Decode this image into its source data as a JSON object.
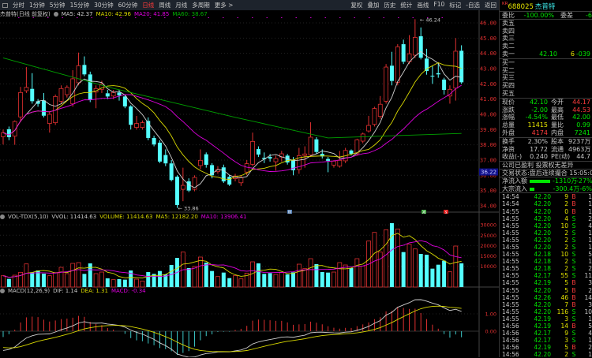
{
  "toolbar": {
    "periods": [
      "分时",
      "1分钟",
      "5分钟",
      "15分钟",
      "30分钟",
      "60分钟",
      "日线",
      "周线",
      "月线",
      "多周期",
      "更多 >"
    ],
    "active_period": "日线",
    "actions": [
      "复权",
      "叠加",
      "历史",
      "统计",
      "画线",
      "F10",
      "标记",
      "-自选",
      "返回"
    ]
  },
  "stock": {
    "market_tag": "KR",
    "code": "688025",
    "name": "杰普特"
  },
  "main_pane": {
    "title": "杰普特(日线 前复权)",
    "ma": [
      {
        "label": "MA5: 42.37",
        "color": "#d0d0d0"
      },
      {
        "label": "MA10: 42.96",
        "color": "#d8d800"
      },
      {
        "label": "MA20: 41.85",
        "color": "#e000e0"
      },
      {
        "label": "MA60: 38.67",
        "color": "#00b000"
      }
    ],
    "high_marker": "46.24",
    "low_marker": "33.86",
    "cursor_price": "36.22",
    "axis_ticks": [
      "46.00",
      "45.00",
      "44.00",
      "43.00",
      "42.00",
      "41.00",
      "40.00",
      "39.00",
      "38.00",
      "37.00",
      "36.00",
      "35.00",
      "34.00"
    ],
    "event_markers": [
      {
        "label": "财",
        "color": "#4a78b0"
      },
      {
        "label": "减",
        "color": "#30a030"
      },
      {
        "label": "$",
        "color": "#e02020"
      }
    ]
  },
  "volume_pane": {
    "title": "VOL-TDX(5,10)",
    "labels": [
      {
        "label": "VVOL: 11414.63",
        "color": "#c8c8c8"
      },
      {
        "label": "VOLUME: 11414.63",
        "color": "#d8d800"
      },
      {
        "label": "MA5: 12182.20",
        "color": "#d8d800"
      },
      {
        "label": "MA10: 13906.41",
        "color": "#e000e0"
      }
    ],
    "axis_ticks": [
      "30000",
      "25000",
      "20000",
      "15000",
      "10000"
    ]
  },
  "macd_pane": {
    "title": "MACD(12,26,9)",
    "labels": [
      {
        "label": "DIF: 1.14",
        "color": "#c8c8c8"
      },
      {
        "label": "DEA: 1.31",
        "color": "#d8d800"
      },
      {
        "label": "MACD: -0.34",
        "color": "#e000e0"
      }
    ],
    "axis_ticks": [
      "1.00",
      "0.00"
    ]
  },
  "colors": {
    "up": "#e03030",
    "down": "#54ffff",
    "ma5": "#d0d0d0",
    "ma10": "#d8d800",
    "ma20": "#e000e0",
    "ma60": "#00a000",
    "axis_text": "#e03030"
  },
  "chart_data": {
    "type": "candlestick",
    "ylim_price": [
      33.5,
      46.5
    ],
    "candles_ohlc": [
      [
        38.53,
        39.0,
        38.02,
        38.79
      ],
      [
        39.02,
        39.2,
        38.3,
        38.5
      ],
      [
        38.57,
        39.6,
        38.0,
        39.53
      ],
      [
        39.83,
        41.8,
        39.5,
        41.43
      ],
      [
        41.55,
        43.1,
        41.4,
        41.77
      ],
      [
        41.67,
        42.7,
        40.7,
        40.86
      ],
      [
        40.86,
        41.0,
        40.5,
        40.69
      ],
      [
        40.91,
        41.4,
        39.8,
        39.91
      ],
      [
        39.4,
        40.2,
        38.8,
        40.0
      ],
      [
        39.45,
        41.3,
        39.3,
        41.17
      ],
      [
        40.86,
        41.9,
        40.7,
        41.69
      ],
      [
        41.29,
        41.9,
        41.1,
        41.77
      ],
      [
        40.69,
        42.9,
        40.5,
        42.33
      ],
      [
        42.07,
        44.05,
        41.9,
        43.19
      ],
      [
        43.24,
        43.8,
        42.5,
        42.62
      ],
      [
        42.62,
        42.8,
        40.8,
        40.95
      ],
      [
        41.46,
        41.9,
        40.4,
        41.69
      ],
      [
        41.64,
        42.2,
        41.4,
        41.98
      ],
      [
        41.38,
        41.6,
        41.0,
        41.17
      ],
      [
        41.2,
        41.6,
        41.0,
        41.43
      ],
      [
        41.43,
        41.6,
        40.9,
        41.24
      ],
      [
        41.17,
        41.3,
        40.4,
        40.52
      ],
      [
        40.52,
        40.6,
        39.0,
        39.31
      ],
      [
        39.14,
        39.9,
        39.0,
        39.4
      ],
      [
        39.14,
        39.6,
        39.0,
        39.45
      ],
      [
        39.57,
        39.8,
        38.3,
        38.45
      ],
      [
        38.45,
        38.6,
        37.9,
        38.02
      ],
      [
        38.14,
        38.3,
        36.8,
        36.9
      ],
      [
        37.33,
        37.7,
        36.6,
        36.78
      ],
      [
        36.78,
        37.0,
        35.6,
        35.69
      ],
      [
        35.91,
        36.0,
        33.86,
        34.05
      ],
      [
        35.08,
        36.5,
        34.3,
        35.34
      ],
      [
        35.6,
        35.8,
        34.9,
        35.0
      ],
      [
        35.08,
        36.0,
        34.95,
        35.86
      ],
      [
        36.64,
        37.7,
        36.4,
        36.98
      ],
      [
        37.38,
        37.5,
        36.5,
        36.69
      ],
      [
        36.67,
        36.8,
        35.8,
        36.0
      ],
      [
        36.24,
        36.6,
        36.1,
        36.38
      ],
      [
        36.52,
        36.7,
        35.5,
        35.6
      ],
      [
        35.9,
        36.0,
        35.3,
        35.39
      ],
      [
        35.78,
        36.1,
        35.6,
        35.95
      ],
      [
        35.51,
        36.0,
        35.3,
        35.86
      ],
      [
        36.21,
        37.0,
        36.0,
        36.76
      ],
      [
        36.72,
        38.8,
        36.6,
        38.22
      ],
      [
        37.72,
        37.9,
        37.2,
        37.36
      ],
      [
        37.15,
        37.5,
        36.8,
        37.07
      ],
      [
        37.2,
        37.4,
        36.9,
        37.1
      ],
      [
        36.89,
        37.3,
        36.3,
        37.1
      ],
      [
        37.2,
        37.6,
        36.9,
        37.41
      ],
      [
        37.29,
        37.4,
        36.7,
        36.84
      ],
      [
        37.03,
        37.2,
        36.0,
        36.33
      ],
      [
        36.38,
        37.8,
        36.1,
        37.29
      ],
      [
        37.3,
        37.9,
        36.5,
        37.4
      ],
      [
        37.33,
        39.48,
        37.2,
        38.5
      ],
      [
        38.36,
        38.5,
        37.4,
        37.53
      ],
      [
        37.41,
        37.7,
        37.1,
        37.24
      ],
      [
        37.07,
        37.2,
        36.2,
        36.95
      ],
      [
        36.67,
        37.0,
        36.5,
        36.93
      ],
      [
        36.6,
        37.6,
        36.5,
        36.98
      ],
      [
        36.95,
        37.8,
        36.8,
        37.63
      ],
      [
        37.63,
        37.7,
        37.3,
        37.41
      ],
      [
        37.41,
        38.4,
        37.3,
        38.33
      ],
      [
        38.24,
        38.8,
        38.1,
        38.71
      ],
      [
        38.91,
        39.9,
        38.8,
        39.27
      ],
      [
        39.34,
        40.5,
        39.2,
        40.38
      ],
      [
        39.86,
        41.2,
        39.7,
        40.66
      ],
      [
        40.86,
        43.3,
        40.7,
        43.1
      ],
      [
        43.19,
        44.1,
        41.9,
        42.19
      ],
      [
        42.1,
        44.6,
        41.9,
        44.43
      ],
      [
        44.6,
        44.9,
        43.3,
        43.45
      ],
      [
        43.45,
        45.2,
        43.3,
        43.97
      ],
      [
        43.88,
        46.24,
        43.7,
        45.05
      ],
      [
        45.12,
        45.7,
        43.6,
        43.71
      ],
      [
        43.66,
        44.3,
        42.6,
        42.84
      ],
      [
        42.53,
        43.2,
        42.0,
        42.5
      ],
      [
        42.7,
        43.4,
        42.4,
        42.62
      ],
      [
        42.28,
        42.4,
        41.3,
        41.6
      ],
      [
        41.2,
        41.9,
        40.7,
        41.64
      ],
      [
        41.72,
        45.0,
        40.9,
        44.14
      ],
      [
        44.17,
        44.53,
        42.0,
        42.1
      ]
    ],
    "volumes": [
      5450,
      3930,
      5700,
      7090,
      11150,
      7090,
      7980,
      6460,
      5450,
      6970,
      9500,
      6460,
      11400,
      11780,
      6330,
      11400,
      6460,
      7220,
      4180,
      3550,
      3800,
      3550,
      7980,
      3800,
      2910,
      7220,
      6330,
      7730,
      6080,
      10640,
      14060,
      16850,
      9120,
      9880,
      14440,
      11780,
      7730,
      5065,
      6970,
      4300,
      5450,
      3930,
      6710,
      12160,
      11400,
      6330,
      6710,
      6080,
      7090,
      6080,
      7090,
      11020,
      8870,
      13680,
      11020,
      7220,
      6970,
      7220,
      11780,
      10640,
      9120,
      13680,
      10130,
      22170,
      26350,
      16850,
      27620,
      30790,
      28000,
      16850,
      20650,
      18370,
      15960,
      15580,
      8870,
      10770,
      12670,
      7350,
      19760,
      11415
    ],
    "ma60_keypoints": [
      [
        0,
        43.7
      ],
      [
        19,
        41.7
      ],
      [
        40,
        39.8
      ],
      [
        56,
        38.45
      ],
      [
        79,
        38.75
      ]
    ]
  },
  "right_panel": {
    "weibi": {
      "label": "委比",
      "value": "-100.00%",
      "label2": "委差",
      "value2": "-6"
    },
    "asks": [
      {
        "label": "卖五",
        "price": "",
        "vol": "",
        "chg": ""
      },
      {
        "label": "卖四",
        "price": "",
        "vol": "",
        "chg": ""
      },
      {
        "label": "卖三",
        "price": "",
        "vol": "",
        "chg": ""
      },
      {
        "label": "卖二",
        "price": "",
        "vol": "",
        "chg": ""
      },
      {
        "label": "卖一",
        "price": "42.10",
        "vol": "6",
        "chg": "-039"
      }
    ],
    "bids": [
      {
        "label": "买一"
      },
      {
        "label": "买二"
      },
      {
        "label": "买三"
      },
      {
        "label": "买四"
      },
      {
        "label": "买五"
      }
    ],
    "quote": [
      {
        "l1": "现价",
        "v1": "42.10",
        "c1": "g",
        "l2": "今开",
        "v2": "44.17",
        "c2": "r"
      },
      {
        "l1": "涨跌",
        "v1": "-2.00",
        "c1": "g",
        "l2": "最高",
        "v2": "44.53",
        "c2": "r"
      },
      {
        "l1": "涨幅",
        "v1": "-4.54%",
        "c1": "g",
        "l2": "最低",
        "v2": "42.00",
        "c2": "g"
      },
      {
        "l1": "总量",
        "v1": "11415",
        "c1": "y",
        "l2": "量比",
        "v2": "0.99",
        "c2": "g"
      },
      {
        "l1": "外盘",
        "v1": "4174",
        "c1": "r",
        "l2": "内盘",
        "v2": "7241",
        "c2": "g"
      }
    ],
    "fundamentals": [
      {
        "l1": "换手",
        "v1": "2.30%",
        "l2": "股本",
        "v2": "9237万"
      },
      {
        "l1": "净资",
        "v1": "17.72",
        "l2": "流通",
        "v2": "4963万"
      },
      {
        "l1": "收益(-)",
        "v1": "0.240",
        "l2": "PE(动)",
        "v2": "44.7"
      }
    ],
    "company_note": "公司已盈利 投票权无差异",
    "trade_status": "交易状态:盘后连续撮合 15:05:00",
    "flows": [
      {
        "label": "净流入额",
        "amount": "-1310万",
        "pct": "-27%",
        "bar_pct": 27
      },
      {
        "label": "大宗流入",
        "amount": "-300.4万",
        "pct": "-6%",
        "bar_pct": 6
      }
    ],
    "ticks": [
      [
        "14:54",
        "42.20",
        "9",
        "B",
        "1"
      ],
      [
        "14:54",
        "42.20",
        "2",
        "B",
        "1"
      ],
      [
        "14:55",
        "42.20",
        "0",
        "B",
        "1"
      ],
      [
        "14:55",
        "42.20",
        "4",
        "S",
        "2"
      ],
      [
        "14:55",
        "42.20",
        "10",
        "S",
        "4"
      ],
      [
        "14:55",
        "42.20",
        "2",
        "S",
        "1"
      ],
      [
        "14:55",
        "42.20",
        "2",
        "S",
        "1"
      ],
      [
        "14:55",
        "42.20",
        "2",
        "S",
        "1"
      ],
      [
        "14:55",
        "42.18",
        "10",
        "S",
        "5"
      ],
      [
        "14:55",
        "42.18",
        "2",
        "S",
        "1"
      ],
      [
        "14:55",
        "42.18",
        "2",
        "S",
        "2"
      ],
      [
        "14:55",
        "42.17",
        "55",
        "S",
        "11"
      ],
      [
        "14:55",
        "42.19",
        "5",
        "B",
        "3"
      ],
      [
        "14:55",
        "42.20",
        "5",
        "B",
        "2"
      ],
      [
        "14:55",
        "42.26",
        "46",
        "B",
        "14"
      ],
      [
        "14:55",
        "42.20",
        "7",
        "B",
        "3"
      ],
      [
        "14:55",
        "42.20",
        "116",
        "S",
        "10"
      ],
      [
        "14:55",
        "42.19",
        "3",
        "S",
        "1"
      ],
      [
        "14:56",
        "42.19",
        "14",
        "B",
        "5"
      ],
      [
        "14:56",
        "42.17",
        "9",
        "S",
        "4"
      ],
      [
        "14:56",
        "42.17",
        "3",
        "S",
        "1"
      ],
      [
        "14:56",
        "42.19",
        "5",
        "B",
        "2"
      ],
      [
        "14:56",
        "42.20",
        "2",
        "S",
        "1"
      ]
    ]
  }
}
